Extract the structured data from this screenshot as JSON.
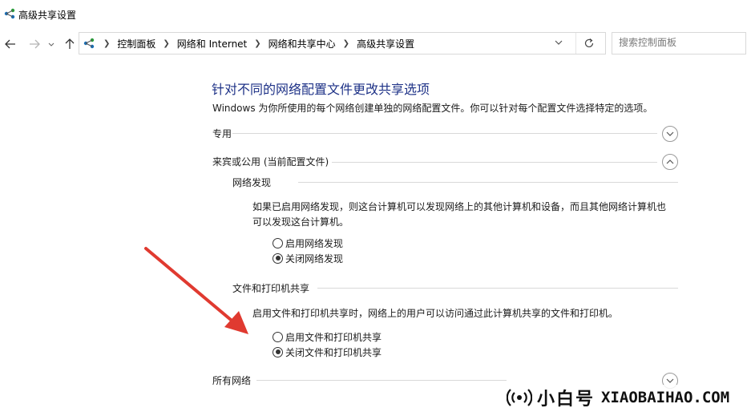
{
  "window": {
    "title": "高级共享设置"
  },
  "breadcrumbs": [
    "控制面板",
    "网络和 Internet",
    "网络和共享中心",
    "高级共享设置"
  ],
  "search": {
    "placeholder": "搜索控制面板"
  },
  "page": {
    "title": "针对不同的网络配置文件更改共享选项",
    "description": "Windows 为你所使用的每个网络创建单独的网络配置文件。你可以针对每个配置文件选择特定的选项。"
  },
  "profiles": [
    {
      "label": "专用",
      "expanded": false
    },
    {
      "label": "来宾或公用 (当前配置文件)",
      "expanded": true
    },
    {
      "label": "所有网络",
      "expanded": false
    }
  ],
  "network_discovery": {
    "heading": "网络发现",
    "description_line1": "如果已启用网络发现，则这台计算机可以发现网络上的其他计算机和设备，而且其他网络计算机也",
    "description_line2": "可以发现这台计算机。",
    "options": [
      {
        "label": "启用网络发现",
        "checked": false
      },
      {
        "label": "关闭网络发现",
        "checked": true
      }
    ]
  },
  "file_printer_sharing": {
    "heading": "文件和打印机共享",
    "description": "启用文件和打印机共享时，网络上的用户可以访问通过此计算机共享的文件和打印机。",
    "options": [
      {
        "label": "启用文件和打印机共享",
        "checked": false
      },
      {
        "label": "关闭文件和打印机共享",
        "checked": true
      }
    ]
  },
  "watermark": {
    "brand_cn": "小白号",
    "brand_en": "XIAOBAIHAO.COM"
  },
  "colors": {
    "title_blue": "#1e3287",
    "arrow_red": "#e03a30"
  }
}
